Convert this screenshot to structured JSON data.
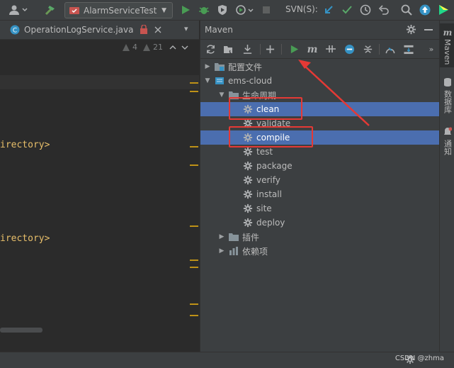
{
  "toolbar": {
    "run_config_label": "AlarmServiceTest",
    "svn_label": "SVN(S):"
  },
  "editor": {
    "tab_filename": "OperationLogService.java",
    "warning_count": "4",
    "weak_warning_count": "21",
    "code_lines": [
      "irectory>",
      "irectory>"
    ]
  },
  "maven": {
    "title": "Maven",
    "tree": {
      "config_files": "配置文件",
      "project": "ems-cloud",
      "lifecycle": "生命周期",
      "goals": [
        "clean",
        "validate",
        "compile",
        "test",
        "package",
        "verify",
        "install",
        "site",
        "deploy"
      ],
      "plugins": "插件",
      "dependencies": "依赖项"
    }
  },
  "right_bar": {
    "maven_tab": "Maven",
    "database_tab": "数据库",
    "notifications_tab": "通知"
  },
  "status": {
    "watermark": "CSDN @zhma"
  },
  "colors": {
    "accent_selection": "#4b6eaf",
    "run_green": "#499c54",
    "annotation_red": "#e53935"
  }
}
